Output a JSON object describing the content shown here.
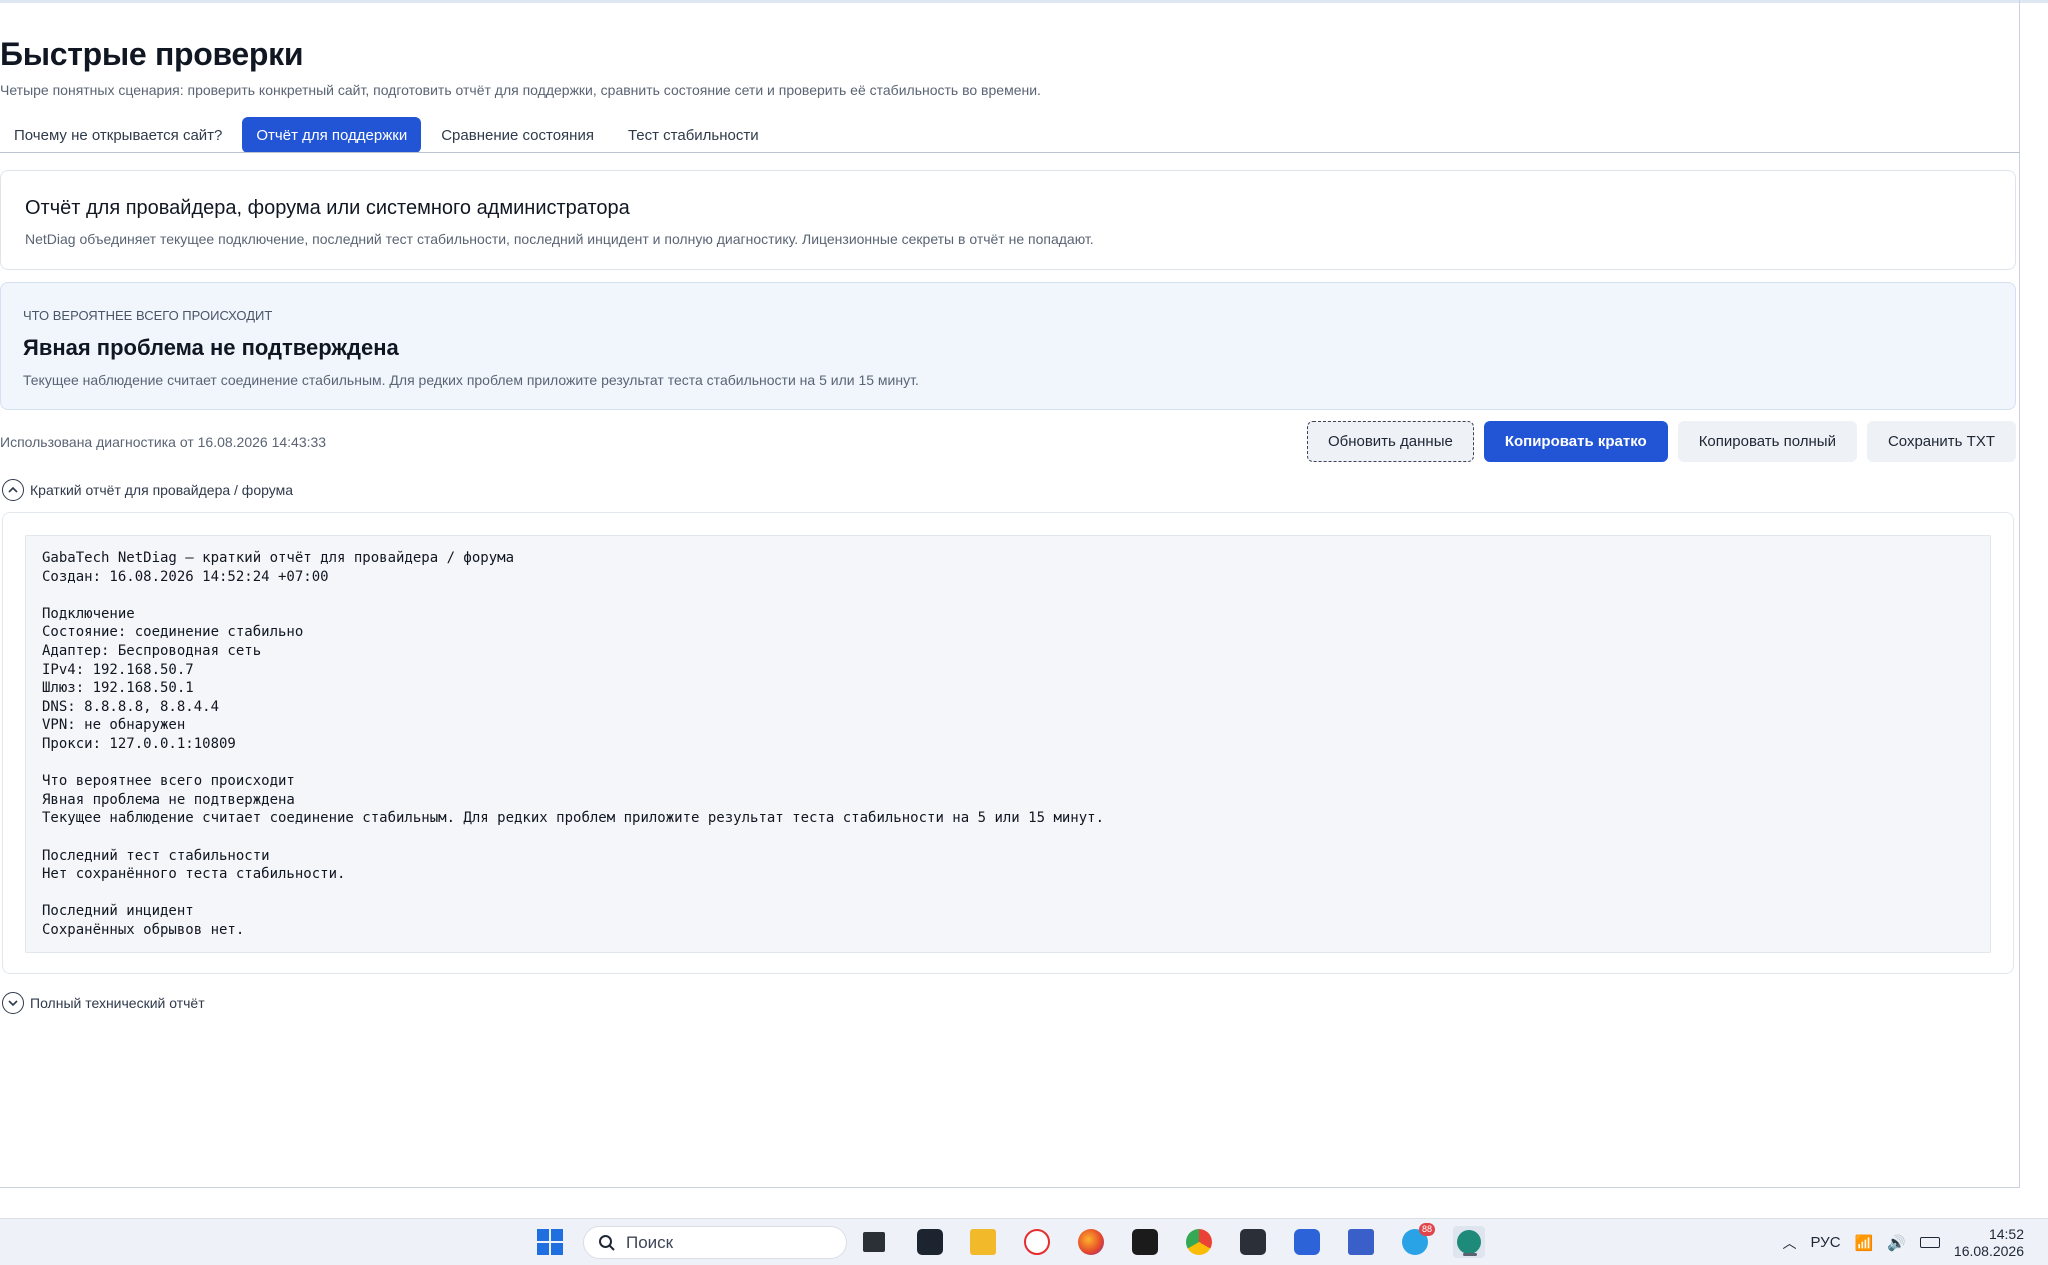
{
  "page": {
    "title": "Быстрые проверки",
    "subtitle": "Четыре понятных сценария: проверить конкретный сайт, подготовить отчёт для поддержки, сравнить состояние сети и проверить её стабильность во времени."
  },
  "tabs": [
    {
      "label": "Почему не открывается сайт?",
      "active": false
    },
    {
      "label": "Отчёт для поддержки",
      "active": true
    },
    {
      "label": "Сравнение состояния",
      "active": false
    },
    {
      "label": "Тест стабильности",
      "active": false
    }
  ],
  "intro": {
    "title": "Отчёт для провайдера, форума или системного администратора",
    "text": "NetDiag объединяет текущее подключение, последний тест стабильности, последний инцидент и полную диагностику. Лицензионные секреты в отчёт не попадают."
  },
  "status": {
    "kicker": "Что вероятнее всего происходит",
    "title": "Явная проблема не подтверждена",
    "text": "Текущее наблюдение считает соединение стабильным. Для редких проблем приложите результат теста стабильности на 5 или 15 минут."
  },
  "diag_meta": "Использована диагностика от 16.08.2026 14:43:33",
  "actions": {
    "refresh": "Обновить данные",
    "copy_short": "Копировать кратко",
    "copy_full": "Копировать полный",
    "save_txt": "Сохранить TXT"
  },
  "short_report": {
    "label": "Краткий отчёт для провайдера / форума",
    "expanded": true,
    "text": "GabaTech NetDiag — краткий отчёт для провайдера / форума\nСоздан: 16.08.2026 14:52:24 +07:00\n\nПодключение\nСостояние: соединение стабильно\nАдаптер: Беспроводная сеть\nIPv4: 192.168.50.7\nШлюз: 192.168.50.1\nDNS: 8.8.8.8, 8.8.4.4\nVPN: не обнаружен\nПрокси: 127.0.0.1:10809\n\nЧто вероятнее всего происходит\nЯвная проблема не подтверждена\nТекущее наблюдение считает соединение стабильным. Для редких проблем приложите результат теста стабильности на 5 или 15 минут.\n\nПоследний тест стабильности\nНет сохранённого теста стабильности.\n\nПоследний инцидент\nСохранённых обрывов нет."
  },
  "full_report": {
    "label": "Полный технический отчёт",
    "expanded": false
  },
  "taskbar": {
    "search_placeholder": "Поиск",
    "language": "РУС",
    "time": "14:52",
    "date": "16.08.2026",
    "telegram_badge": "88",
    "accent": "#2255d6"
  }
}
